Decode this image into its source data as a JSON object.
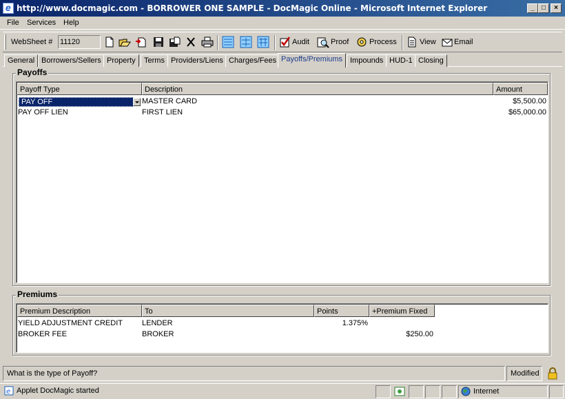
{
  "window": {
    "title": "http://www.docmagic.com - BORROWER ONE SAMPLE - DocMagic Online - Microsoft Internet Explorer",
    "minimize": "_",
    "maximize": "□",
    "close": "×"
  },
  "menu": {
    "file": "File",
    "services": "Services",
    "help": "Help"
  },
  "toolbar": {
    "websheet_label": "WebSheet #",
    "websheet_value": "11120",
    "audit": "Audit",
    "proof": "Proof",
    "process": "Process",
    "view": "View",
    "email": "Email",
    "icons": [
      "new-icon",
      "open-icon",
      "import-icon",
      "save-icon",
      "save-as-icon",
      "delete-icon",
      "print-icon",
      "app-form-icon",
      "calc-icon",
      "imp-icon"
    ]
  },
  "tabs": [
    {
      "label": "General"
    },
    {
      "label": "Borrowers/Sellers"
    },
    {
      "label": "Property"
    },
    {
      "label": "Terms"
    },
    {
      "label": "Providers/Liens"
    },
    {
      "label": "Charges/Fees"
    },
    {
      "label": "Payoffs/Premiums",
      "active": true
    },
    {
      "label": "Impounds"
    },
    {
      "label": "HUD-1"
    },
    {
      "label": "Closing"
    }
  ],
  "payoffs": {
    "title": "Payoffs",
    "columns": [
      "Payoff Type",
      "Description",
      "Amount"
    ],
    "rows": [
      {
        "type": "PAY OFF",
        "description": "MASTER CARD",
        "amount": "$5,500.00"
      },
      {
        "type": "PAY OFF LIEN",
        "description": "FIRST LIEN",
        "amount": "$65,000.00"
      }
    ]
  },
  "premiums": {
    "title": "Premiums",
    "columns": [
      "Premium Description",
      "To",
      "Points",
      "+Premium Fixed"
    ],
    "rows": [
      {
        "description": "YIELD ADJUSTMENT CREDIT",
        "to": "LENDER",
        "points": "1.375%",
        "fixed": ""
      },
      {
        "description": "BROKER FEE",
        "to": "BROKER",
        "points": "",
        "fixed": "$250.00"
      }
    ]
  },
  "status": {
    "help_text": "What is the type of Payoff?",
    "modified": "Modified"
  },
  "iestatus": {
    "message": "Applet DocMagic started",
    "zone": "Internet"
  },
  "colors": {
    "titlebar": "#0a246a",
    "selection": "#0a246a",
    "face": "#d4d0c8",
    "active_tab_text": "#1c3c8c"
  }
}
